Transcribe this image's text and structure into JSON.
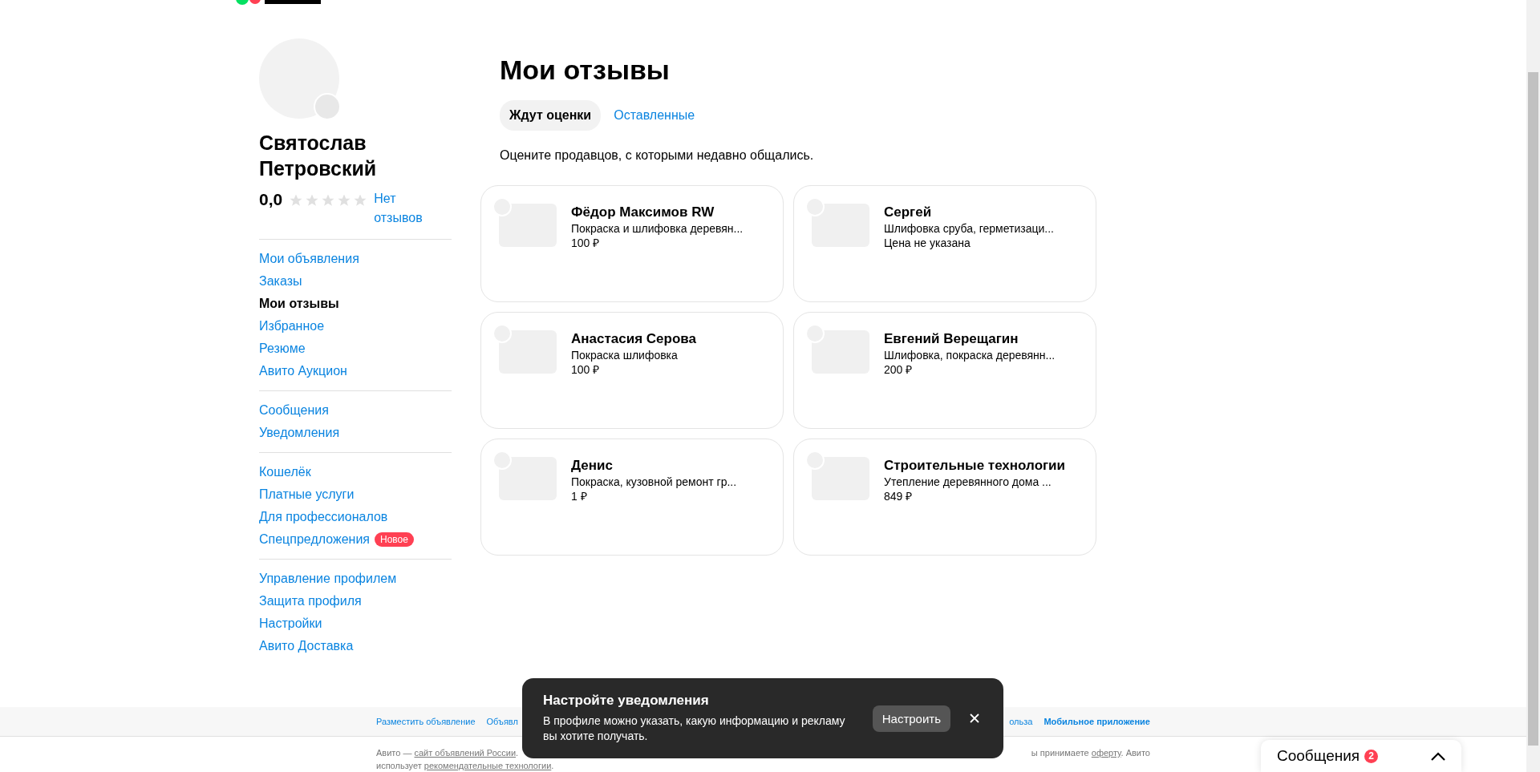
{
  "profile": {
    "name": "Святослав Петровский",
    "rating": "0,0",
    "stars": 0,
    "reviews_link": "Нет отзывов"
  },
  "sidebar": {
    "groups": [
      [
        {
          "label": "Мои объявления",
          "selected": false
        },
        {
          "label": "Заказы",
          "selected": false
        },
        {
          "label": "Мои отзывы",
          "selected": true
        },
        {
          "label": "Избранное",
          "selected": false
        },
        {
          "label": "Резюме",
          "selected": false
        },
        {
          "label": "Авито Аукцион",
          "selected": false
        }
      ],
      [
        {
          "label": "Сообщения",
          "selected": false
        },
        {
          "label": "Уведомления",
          "selected": false
        }
      ],
      [
        {
          "label": "Кошелёк",
          "selected": false
        },
        {
          "label": "Платные услуги",
          "selected": false
        },
        {
          "label": "Для профессионалов",
          "selected": false
        },
        {
          "label": "Спецпредложения",
          "selected": false,
          "badge": "Новое"
        }
      ],
      [
        {
          "label": "Управление профилем",
          "selected": false
        },
        {
          "label": "Защита профиля",
          "selected": false
        },
        {
          "label": "Настройки",
          "selected": false
        },
        {
          "label": "Авито Доставка",
          "selected": false
        }
      ]
    ]
  },
  "page_title": "Мои отзывы",
  "tabs": [
    {
      "label": "Ждут оценки",
      "selected": true
    },
    {
      "label": "Оставленные",
      "selected": false
    }
  ],
  "hint": "Оцените продавцов, с которыми недавно общались.",
  "cards": [
    {
      "seller": "Фёдор Максимов RW",
      "title": "Покраска и шлифовка деревян...",
      "price": "100 ₽"
    },
    {
      "seller": "Сергей",
      "title": "Шлифовка сруба, герметизаци...",
      "price": "Цена не указана"
    },
    {
      "seller": "Анастасия Серова",
      "title": "Покраска шлифовка",
      "price": "100 ₽"
    },
    {
      "seller": "Евгений Верещагин",
      "title": "Шлифовка, покраска деревянн...",
      "price": "200 ₽"
    },
    {
      "seller": "Денис",
      "title": "Покраска, кузовной ремонт гр...",
      "price": "1 ₽"
    },
    {
      "seller": "Строительные технологии",
      "title": "Утепление деревянного дома ...",
      "price": "849 ₽"
    }
  ],
  "footer": {
    "links_left": [
      "Разместить объявление",
      "Объявл"
    ],
    "links_right": [
      "ольза",
      "Мобильное приложение"
    ],
    "legal_left": "Авито — ",
    "legal_link": "сайт объявлений России",
    "legal_left_end": ".",
    "legal_right": "ы принимаете ",
    "legal_right_link": "оферту",
    "legal_right_end": ". Авито",
    "legal_line2": "использует ",
    "legal_line2_link": "рекомендательные технологии",
    "legal_line2_end": "."
  },
  "toast": {
    "title": "Настройте уведомления",
    "text": "В профиле можно указать, какую информацию и рекламу вы хотите получать.",
    "button": "Настроить"
  },
  "messages_widget": {
    "label": "Сообщения",
    "count": "2"
  }
}
